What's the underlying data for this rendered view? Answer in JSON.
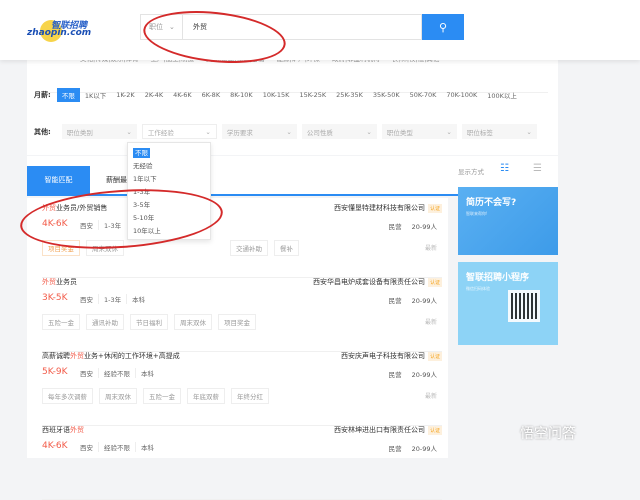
{
  "brand": {
    "logo_cn": "智联招聘",
    "logo_en": "zhaopin.com"
  },
  "search": {
    "type_select": "职位",
    "query": "外贸",
    "button_icon": "search-icon"
  },
  "industries": [
    "文化|传媒|娱乐|体育",
    "生产|加工|制造",
    "交通|运输|物流|仓储",
    "能源|矿产|环保",
    "政府|非盈利机构",
    "农|林|牧|渔|其他"
  ],
  "salary": {
    "label": "月薪:",
    "options": [
      "不限",
      "1K以下",
      "1K-2K",
      "2K-4K",
      "4K-6K",
      "6K-8K",
      "8K-10K",
      "10K-15K",
      "15K-25K",
      "25K-35K",
      "35K-50K",
      "50K-70K",
      "70K-100K",
      "100K以上"
    ],
    "selected": "不限"
  },
  "other": {
    "label": "其他:",
    "filters": [
      "职位类别",
      "工作经验",
      "学历要求",
      "公司性质",
      "职位类型",
      "职位标签"
    ],
    "active": "工作经验"
  },
  "experience_dropdown": {
    "options": [
      "不限",
      "无经验",
      "1年以下",
      "1-3年",
      "3-5年",
      "5-10年",
      "10年以上"
    ],
    "selected": "不限"
  },
  "tabs": [
    {
      "label": "智能匹配",
      "active": true
    },
    {
      "label": "薪酬最",
      "active": false
    }
  ],
  "view": {
    "label": "显示方式"
  },
  "jobs": [
    {
      "title_pre": "外贸",
      "title_post": "业务员/外贸销售",
      "salary": "4K-6K",
      "meta": [
        "西安",
        "1-3年"
      ],
      "company": "西安懂垦特建材科技有限公司",
      "badge": "认证",
      "type": "民营",
      "size": "20-99人",
      "tags": [
        "项目奖金",
        "周末双休",
        "交通补助",
        "餐补"
      ],
      "update": "最新"
    },
    {
      "title_pre": "",
      "title_hl": "外贸",
      "title_post": "业务员",
      "salary": "3K-5K",
      "meta": [
        "西安",
        "1-3年",
        "本科"
      ],
      "company": "西安华昌电炉成套设备有限责任公司",
      "badge": "认证",
      "type": "民营",
      "size": "20-99人",
      "tags": [
        "五险一金",
        "通讯补助",
        "节日福利",
        "周末双休",
        "项目奖金"
      ],
      "update": "最新"
    },
    {
      "title_pre": "高薪诚聘",
      "title_hl": "外贸",
      "title_post": "业务+休闲的工作环境+高提成",
      "salary": "5K-9K",
      "meta": [
        "西安",
        "经验不限",
        "本科"
      ],
      "company": "西安庆声电子科技有限公司",
      "badge": "认证",
      "type": "民营",
      "size": "20-99人",
      "tags": [
        "每年多次调薪",
        "周末双休",
        "五险一金",
        "年底双薪",
        "年终分红"
      ],
      "update": "最新"
    },
    {
      "title_pre": "西班牙语",
      "title_hl": "外贸",
      "title_post": "",
      "salary": "4K-6K",
      "meta": [
        "西安",
        "经验不限",
        "本科"
      ],
      "company": "西安林坤进出口有限责任公司",
      "badge": "认证",
      "type": "民营",
      "size": "20-99人",
      "tags": [],
      "update": ""
    }
  ],
  "ads": [
    {
      "title": "简历不会写?",
      "sub": "智联来帮你!"
    },
    {
      "title": "智联招聘小程序",
      "sub": "微信扫码体验"
    }
  ],
  "watermark": "悟空问答",
  "colors": {
    "accent": "#2b8cf3",
    "salary": "#f25c4a",
    "annotation": "#d42a2a"
  }
}
